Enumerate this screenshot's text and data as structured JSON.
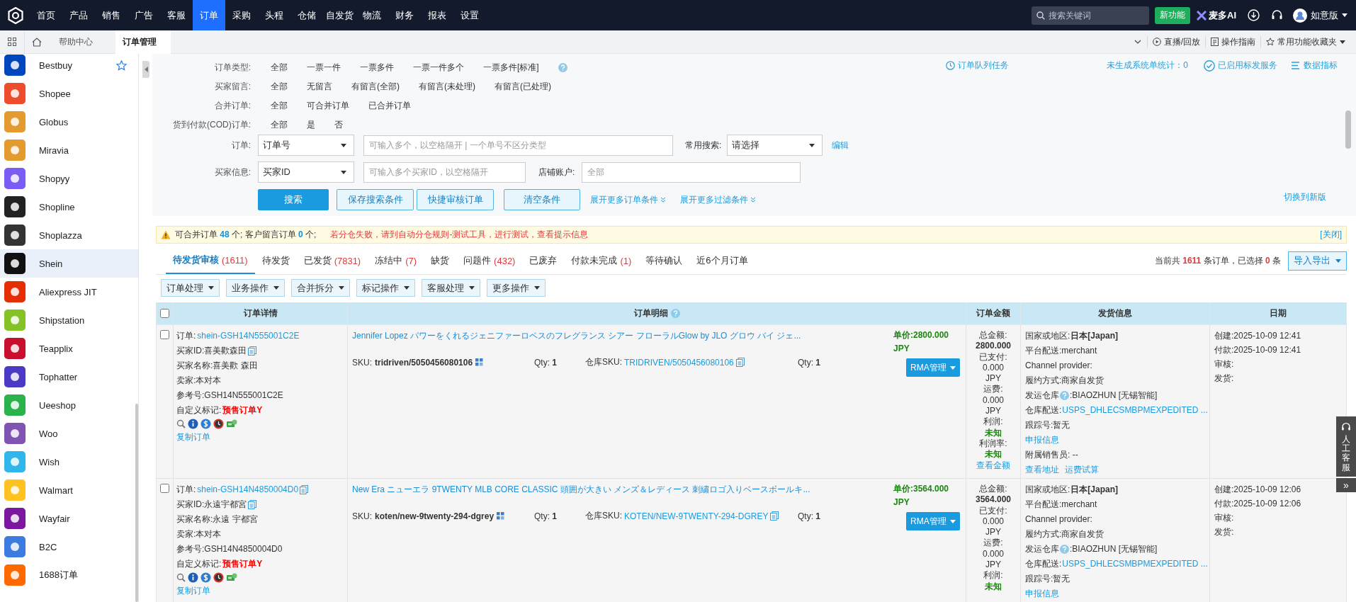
{
  "nav": {
    "items": [
      {
        "label": "首页",
        "selected": false
      },
      {
        "label": "产品",
        "selected": false
      },
      {
        "label": "销售",
        "selected": false
      },
      {
        "label": "广告",
        "selected": false
      },
      {
        "label": "客服",
        "selected": false
      },
      {
        "label": "订单",
        "selected": true
      },
      {
        "label": "采购",
        "selected": false
      },
      {
        "label": "头程",
        "selected": false
      },
      {
        "label": "仓储",
        "selected": false
      },
      {
        "label": "自发货",
        "selected": false
      },
      {
        "label": "物流",
        "selected": false
      },
      {
        "label": "财务",
        "selected": false
      },
      {
        "label": "报表",
        "selected": false
      },
      {
        "label": "设置",
        "selected": false
      }
    ],
    "search_placeholder": "搜索关键词",
    "new_feature": "新功能",
    "ai": "麦多AI",
    "user": "如意版"
  },
  "tabbar": {
    "tabs": [
      {
        "label": "帮助中心",
        "selected": false
      },
      {
        "label": "订单管理",
        "selected": true
      }
    ],
    "actions": [
      {
        "label": "直播/回放",
        "kind": "play"
      },
      {
        "label": "操作指南",
        "kind": "doc"
      },
      {
        "label": "常用功能收藏夹",
        "kind": "star"
      }
    ]
  },
  "sidebar": {
    "items": [
      {
        "label": "Bestbuy",
        "color": "#0046be",
        "favorite": true,
        "selected": false
      },
      {
        "label": "Shopee",
        "color": "#ee4d2d",
        "favorite": false,
        "selected": false
      },
      {
        "label": "Globus",
        "color": "#e39a2f",
        "favorite": false,
        "selected": false
      },
      {
        "label": "Miravia",
        "color": "#e39a2f",
        "favorite": false,
        "selected": false
      },
      {
        "label": "Shopyy",
        "color": "#7b5cf5",
        "favorite": false,
        "selected": false
      },
      {
        "label": "Shopline",
        "color": "#222222",
        "favorite": false,
        "selected": false
      },
      {
        "label": "Shoplazza",
        "color": "#333333",
        "favorite": false,
        "selected": false
      },
      {
        "label": "Shein",
        "color": "#111111",
        "favorite": false,
        "selected": true
      },
      {
        "label": "Aliexpress JIT",
        "color": "#e62e04",
        "favorite": false,
        "selected": false
      },
      {
        "label": "Shipstation",
        "color": "#84c225",
        "favorite": false,
        "selected": false
      },
      {
        "label": "Teapplix",
        "color": "#c8102e",
        "favorite": false,
        "selected": false
      },
      {
        "label": "Tophatter",
        "color": "#4b3bc4",
        "favorite": false,
        "selected": false
      },
      {
        "label": "Ueeshop",
        "color": "#2ab24b",
        "favorite": false,
        "selected": false
      },
      {
        "label": "Woo",
        "color": "#7f54b3",
        "favorite": false,
        "selected": false
      },
      {
        "label": "Wish",
        "color": "#2fb7ec",
        "favorite": false,
        "selected": false
      },
      {
        "label": "Walmart",
        "color": "#ffc220",
        "favorite": false,
        "selected": false
      },
      {
        "label": "Wayfair",
        "color": "#7b189f",
        "favorite": false,
        "selected": false
      },
      {
        "label": "B2C",
        "color": "#3d7be0",
        "favorite": false,
        "selected": false
      },
      {
        "label": "1688订单",
        "color": "#ff6a00",
        "favorite": false,
        "selected": false
      }
    ]
  },
  "filters": [
    {
      "label": "订单类型:",
      "options": [
        "全部",
        "一票一件",
        "一票多件",
        "一票一件多个",
        "一票多件[标准]"
      ],
      "help": true
    },
    {
      "label": "买家留言:",
      "options": [
        "全部",
        "无留言",
        "有留言(全部)",
        "有留言(未处理)",
        "有留言(已处理)"
      ],
      "help": false
    },
    {
      "label": "合并订单:",
      "options": [
        "全部",
        "可合并订单",
        "已合并订单"
      ],
      "help": false
    },
    {
      "label": "货到付款(COD)订单:",
      "options": [
        "全部",
        "是",
        "否"
      ],
      "help": false
    }
  ],
  "search_form": {
    "order": {
      "label": "订单:",
      "select": "订单号",
      "placeholder": "可输入多个，以空格隔开 | 一个单号不区分类型"
    },
    "common": {
      "label": "常用搜索:",
      "select": "请选择",
      "edit": "编辑"
    },
    "buyer": {
      "label": "买家信息:",
      "select": "买家ID",
      "placeholder": "可输入多个买家ID，以空格隔开"
    },
    "store": {
      "label": "店铺账户:",
      "placeholder": "全部"
    },
    "buttons": [
      {
        "label": "搜索",
        "kind": "primary"
      },
      {
        "label": "保存搜索条件",
        "kind": "secondary"
      },
      {
        "label": "快捷审核订单",
        "kind": "secondary"
      },
      {
        "label": "清空条件",
        "kind": "wide"
      }
    ],
    "links": [
      "展开更多订单条件",
      "展开更多过滤条件"
    ]
  },
  "top_links": {
    "queue": "订单队列任务",
    "stat": "未生成系统单统计：0",
    "service": "已启用标发服务",
    "metrics": "数据指标",
    "switch": "切换到新版"
  },
  "notice": {
    "text": "可合并订单 **48** 个; 客户留言订单 **0** 个;",
    "alert": "若分仓失败，请到自动分仓规则-测试工具，进行测试，查看提示信息",
    "close": "[关闭]"
  },
  "status_tabs": [
    {
      "label": "待发货审核",
      "count": "(1611)",
      "selected": true
    },
    {
      "label": "待发货",
      "selected": false
    },
    {
      "label": "已发货",
      "count": "(7831)",
      "selected": false
    },
    {
      "label": "冻结中",
      "count": "(7)",
      "selected": false
    },
    {
      "label": "缺货",
      "selected": false
    },
    {
      "label": "问题件",
      "count": "(432)",
      "selected": false
    },
    {
      "label": "已废弃",
      "selected": false
    },
    {
      "label": "付款未完成",
      "count": "(1)",
      "selected": false
    },
    {
      "label": "等待确认",
      "selected": false
    },
    {
      "label": "近6个月订单",
      "selected": false
    }
  ],
  "summary": "当前共 **1611** 条订单，已选择 **0** 条",
  "export": "导入导出",
  "toolbar": [
    "订单处理",
    "业务操作",
    "合并拆分",
    "标记操作",
    "客服处理",
    "更多操作"
  ],
  "table": {
    "select_all": false,
    "columns": [
      {
        "label": "订单详情",
        "help": false
      },
      {
        "label": "订单明细",
        "help": true
      },
      {
        "label": "订单金额",
        "help": false
      },
      {
        "label": "发货信息",
        "help": false
      },
      {
        "label": "日期",
        "help": false
      }
    ],
    "rows": [
      {
        "checked": false,
        "details": [
          {
            "label": "订单:",
            "value": "shein-GSH14N555001C2E",
            "kind": "link",
            "copy": false
          },
          {
            "text": "买家ID:喜美歡森田",
            "kind": "text",
            "copy": true
          },
          {
            "text": "买家名称:喜美歡 森田",
            "kind": "text",
            "copy": false
          },
          {
            "text": "卖家:本对本",
            "kind": "text",
            "copy": false
          },
          {
            "text": "参考号:GSH14N555001C2E",
            "kind": "text",
            "copy": false
          },
          {
            "label": "自定义标记:",
            "value": "预售订单Y",
            "kind": "alert",
            "copy": false
          }
        ],
        "copy_order": "复制订单",
        "item": {
          "title": "Jennifer Lopez パワーをくれるジェニファーロペスのフレグランス シアー フローラルGlow by JLO グロウ バイ ジェ...",
          "sku": {
            "label": "SKU:",
            "value": "tridriven/5050456080106"
          },
          "qty": {
            "label": "Qty:",
            "value": "1"
          },
          "warehouse_sku": {
            "label": "仓库SKU:",
            "value": "TRIDRIVEN/5050456080106"
          },
          "warehouse_qty": {
            "label": "Qty:",
            "value": "1"
          },
          "price": "单价:2800.000",
          "currency": "JPY",
          "rma": "RMA管理"
        },
        "amounts": [
          {
            "text": "总金额:",
            "kind": "label"
          },
          {
            "text": "2800.000",
            "kind": "strong"
          },
          {
            "text": "已支付:",
            "kind": "label"
          },
          {
            "text": "0.000",
            "kind": "label"
          },
          {
            "text": "JPY",
            "kind": "label"
          },
          {
            "text": "运费:",
            "kind": "label"
          },
          {
            "text": "0.000",
            "kind": "label"
          },
          {
            "text": "JPY",
            "kind": "label"
          },
          {
            "text": "利润:",
            "kind": "label"
          },
          {
            "text": "未知",
            "kind": "good"
          },
          {
            "text": "利润率:",
            "kind": "label"
          },
          {
            "text": "未知",
            "kind": "good"
          },
          {
            "text": "查看金额",
            "kind": "link"
          }
        ],
        "shipping": [
          {
            "label": "国家或地区:",
            "value": "日本[Japan]",
            "kind": "bold"
          },
          {
            "text": "平台配送:merchant",
            "kind": "text"
          },
          {
            "text": "Channel provider:",
            "kind": "text"
          },
          {
            "text": "履约方式:商家自发货",
            "kind": "text"
          },
          {
            "label": "发运仓库",
            "value": ":BIAOZHUN [无锡智能]",
            "kind": "help"
          },
          {
            "label": "仓库配送:",
            "value": "USPS_DHLECSMBPMEXPEDITED ...",
            "kind": "link"
          },
          {
            "text": "跟踪号:暂无",
            "kind": "text"
          },
          {
            "links": [
              "申报信息"
            ],
            "kind": "links"
          },
          {
            "text": "附属销售员: --",
            "kind": "text"
          },
          {
            "links": [
              "查看地址",
              "运费试算"
            ],
            "kind": "links"
          }
        ],
        "dates": [
          "创建:2025-10-09 12:41",
          "付款:2025-10-09 12:41",
          "审核:",
          "发货:"
        ]
      },
      {
        "checked": false,
        "details": [
          {
            "label": "订单:",
            "value": "shein-GSH14N4850004D0",
            "kind": "link",
            "copy": true
          },
          {
            "text": "买家ID:永遠宇都宮",
            "kind": "text",
            "copy": true
          },
          {
            "text": "买家名称:永遠 宇都宮",
            "kind": "text",
            "copy": false
          },
          {
            "text": "卖家:本对本",
            "kind": "text",
            "copy": false
          },
          {
            "text": "参考号:GSH14N4850004D0",
            "kind": "text",
            "copy": false
          },
          {
            "label": "自定义标记:",
            "value": "预售订单Y",
            "kind": "alert",
            "copy": false
          }
        ],
        "copy_order": "复制订单",
        "item": {
          "title": "New Era ニューエラ 9TWENTY MLB CORE CLASSIC 頭囲が大きい メンズ＆レディース 刺繍ロゴ入りベースボールキ...",
          "sku": {
            "label": "SKU:",
            "value": "koten/new-9twenty-294-dgrey"
          },
          "qty": {
            "label": "Qty:",
            "value": "1"
          },
          "warehouse_sku": {
            "label": "仓库SKU:",
            "value": "KOTEN/NEW-9TWENTY-294-DGREY"
          },
          "warehouse_qty": {
            "label": "Qty:",
            "value": "1"
          },
          "price": "单价:3564.000",
          "currency": "JPY",
          "rma": "RMA管理"
        },
        "amounts": [
          {
            "text": "总金额:",
            "kind": "label"
          },
          {
            "text": "3564.000",
            "kind": "strong"
          },
          {
            "text": "已支付:",
            "kind": "label"
          },
          {
            "text": "0.000",
            "kind": "label"
          },
          {
            "text": "JPY",
            "kind": "label"
          },
          {
            "text": "运费:",
            "kind": "label"
          },
          {
            "text": "0.000",
            "kind": "label"
          },
          {
            "text": "JPY",
            "kind": "label"
          },
          {
            "text": "利润:",
            "kind": "label"
          },
          {
            "text": "未知",
            "kind": "good"
          }
        ],
        "shipping": [
          {
            "label": "国家或地区:",
            "value": "日本[Japan]",
            "kind": "bold"
          },
          {
            "text": "平台配送:merchant",
            "kind": "text"
          },
          {
            "text": "Channel provider:",
            "kind": "text"
          },
          {
            "text": "履约方式:商家自发货",
            "kind": "text"
          },
          {
            "label": "发运仓库",
            "value": ":BIAOZHUN [无锡智能]",
            "kind": "help"
          },
          {
            "label": "仓库配送:",
            "value": "USPS_DHLECSMBPMEXPEDITED ...",
            "kind": "link"
          },
          {
            "text": "跟踪号:暂无",
            "kind": "text"
          },
          {
            "links": [
              "申报信息"
            ],
            "kind": "links"
          }
        ],
        "dates": [
          "创建:2025-10-09 12:06",
          "付款:2025-10-09 12:06",
          "审核:",
          "发货:"
        ]
      }
    ]
  },
  "support": {
    "label": "人工客服",
    "collapse": "»"
  }
}
